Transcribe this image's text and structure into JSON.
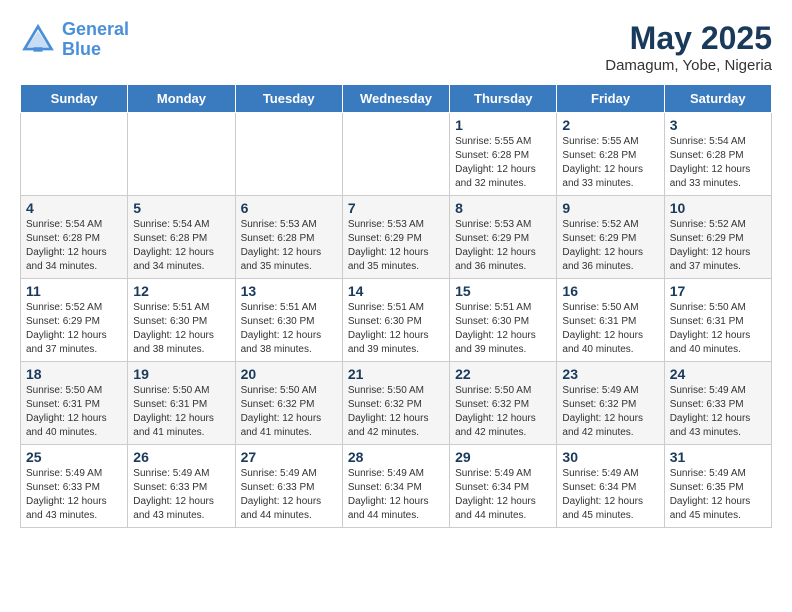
{
  "header": {
    "logo_line1": "General",
    "logo_line2": "Blue",
    "month": "May 2025",
    "location": "Damagum, Yobe, Nigeria"
  },
  "days": [
    "Sunday",
    "Monday",
    "Tuesday",
    "Wednesday",
    "Thursday",
    "Friday",
    "Saturday"
  ],
  "weeks": [
    [
      {
        "date": "",
        "text": ""
      },
      {
        "date": "",
        "text": ""
      },
      {
        "date": "",
        "text": ""
      },
      {
        "date": "",
        "text": ""
      },
      {
        "date": "1",
        "text": "Sunrise: 5:55 AM\nSunset: 6:28 PM\nDaylight: 12 hours\nand 32 minutes."
      },
      {
        "date": "2",
        "text": "Sunrise: 5:55 AM\nSunset: 6:28 PM\nDaylight: 12 hours\nand 33 minutes."
      },
      {
        "date": "3",
        "text": "Sunrise: 5:54 AM\nSunset: 6:28 PM\nDaylight: 12 hours\nand 33 minutes."
      }
    ],
    [
      {
        "date": "4",
        "text": "Sunrise: 5:54 AM\nSunset: 6:28 PM\nDaylight: 12 hours\nand 34 minutes."
      },
      {
        "date": "5",
        "text": "Sunrise: 5:54 AM\nSunset: 6:28 PM\nDaylight: 12 hours\nand 34 minutes."
      },
      {
        "date": "6",
        "text": "Sunrise: 5:53 AM\nSunset: 6:28 PM\nDaylight: 12 hours\nand 35 minutes."
      },
      {
        "date": "7",
        "text": "Sunrise: 5:53 AM\nSunset: 6:29 PM\nDaylight: 12 hours\nand 35 minutes."
      },
      {
        "date": "8",
        "text": "Sunrise: 5:53 AM\nSunset: 6:29 PM\nDaylight: 12 hours\nand 36 minutes."
      },
      {
        "date": "9",
        "text": "Sunrise: 5:52 AM\nSunset: 6:29 PM\nDaylight: 12 hours\nand 36 minutes."
      },
      {
        "date": "10",
        "text": "Sunrise: 5:52 AM\nSunset: 6:29 PM\nDaylight: 12 hours\nand 37 minutes."
      }
    ],
    [
      {
        "date": "11",
        "text": "Sunrise: 5:52 AM\nSunset: 6:29 PM\nDaylight: 12 hours\nand 37 minutes."
      },
      {
        "date": "12",
        "text": "Sunrise: 5:51 AM\nSunset: 6:30 PM\nDaylight: 12 hours\nand 38 minutes."
      },
      {
        "date": "13",
        "text": "Sunrise: 5:51 AM\nSunset: 6:30 PM\nDaylight: 12 hours\nand 38 minutes."
      },
      {
        "date": "14",
        "text": "Sunrise: 5:51 AM\nSunset: 6:30 PM\nDaylight: 12 hours\nand 39 minutes."
      },
      {
        "date": "15",
        "text": "Sunrise: 5:51 AM\nSunset: 6:30 PM\nDaylight: 12 hours\nand 39 minutes."
      },
      {
        "date": "16",
        "text": "Sunrise: 5:50 AM\nSunset: 6:31 PM\nDaylight: 12 hours\nand 40 minutes."
      },
      {
        "date": "17",
        "text": "Sunrise: 5:50 AM\nSunset: 6:31 PM\nDaylight: 12 hours\nand 40 minutes."
      }
    ],
    [
      {
        "date": "18",
        "text": "Sunrise: 5:50 AM\nSunset: 6:31 PM\nDaylight: 12 hours\nand 40 minutes."
      },
      {
        "date": "19",
        "text": "Sunrise: 5:50 AM\nSunset: 6:31 PM\nDaylight: 12 hours\nand 41 minutes."
      },
      {
        "date": "20",
        "text": "Sunrise: 5:50 AM\nSunset: 6:32 PM\nDaylight: 12 hours\nand 41 minutes."
      },
      {
        "date": "21",
        "text": "Sunrise: 5:50 AM\nSunset: 6:32 PM\nDaylight: 12 hours\nand 42 minutes."
      },
      {
        "date": "22",
        "text": "Sunrise: 5:50 AM\nSunset: 6:32 PM\nDaylight: 12 hours\nand 42 minutes."
      },
      {
        "date": "23",
        "text": "Sunrise: 5:49 AM\nSunset: 6:32 PM\nDaylight: 12 hours\nand 42 minutes."
      },
      {
        "date": "24",
        "text": "Sunrise: 5:49 AM\nSunset: 6:33 PM\nDaylight: 12 hours\nand 43 minutes."
      }
    ],
    [
      {
        "date": "25",
        "text": "Sunrise: 5:49 AM\nSunset: 6:33 PM\nDaylight: 12 hours\nand 43 minutes."
      },
      {
        "date": "26",
        "text": "Sunrise: 5:49 AM\nSunset: 6:33 PM\nDaylight: 12 hours\nand 43 minutes."
      },
      {
        "date": "27",
        "text": "Sunrise: 5:49 AM\nSunset: 6:33 PM\nDaylight: 12 hours\nand 44 minutes."
      },
      {
        "date": "28",
        "text": "Sunrise: 5:49 AM\nSunset: 6:34 PM\nDaylight: 12 hours\nand 44 minutes."
      },
      {
        "date": "29",
        "text": "Sunrise: 5:49 AM\nSunset: 6:34 PM\nDaylight: 12 hours\nand 44 minutes."
      },
      {
        "date": "30",
        "text": "Sunrise: 5:49 AM\nSunset: 6:34 PM\nDaylight: 12 hours\nand 45 minutes."
      },
      {
        "date": "31",
        "text": "Sunrise: 5:49 AM\nSunset: 6:35 PM\nDaylight: 12 hours\nand 45 minutes."
      }
    ]
  ]
}
